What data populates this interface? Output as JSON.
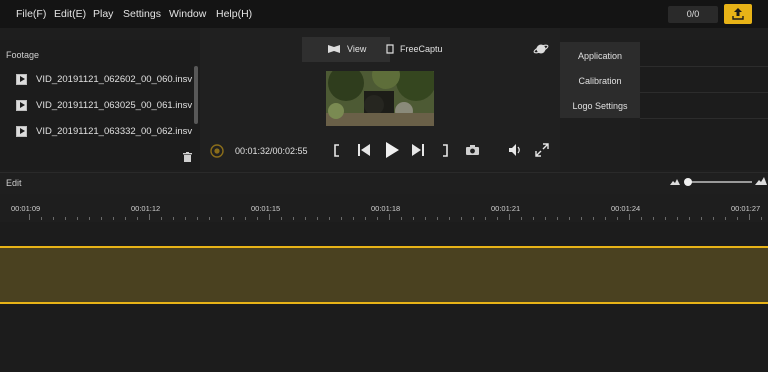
{
  "menu": {
    "file": "File(F)",
    "edit": "Edit(E)",
    "play": "Play",
    "settings": "Settings",
    "window": "Window",
    "help": "Help(H)"
  },
  "toolbar": {
    "counter": "0/0",
    "export_icon": "upload-icon"
  },
  "footage": {
    "title": "Footage",
    "files": [
      "VID_20191121_062602_00_060.insv",
      "VID_20191121_063025_00_061.insv",
      "VID_20191121_063332_00_062.insv"
    ]
  },
  "preview": {
    "view_tab": "View",
    "free_tab": "FreeCaptu",
    "timecode": "00:01:32/00:02:55"
  },
  "settings_menu": {
    "items": [
      "Application",
      "Calibration",
      "Logo Settings"
    ]
  },
  "edit": {
    "title": "Edit",
    "zoom_level": 0.05,
    "ruler": [
      "00:01:09",
      "00:01:12",
      "00:01:15",
      "00:01:18",
      "00:01:21",
      "00:01:24",
      "00:01:27"
    ]
  },
  "colors": {
    "accent": "#e8b317",
    "clip_fill": "#4a4120",
    "background": "#1e1e1e"
  }
}
